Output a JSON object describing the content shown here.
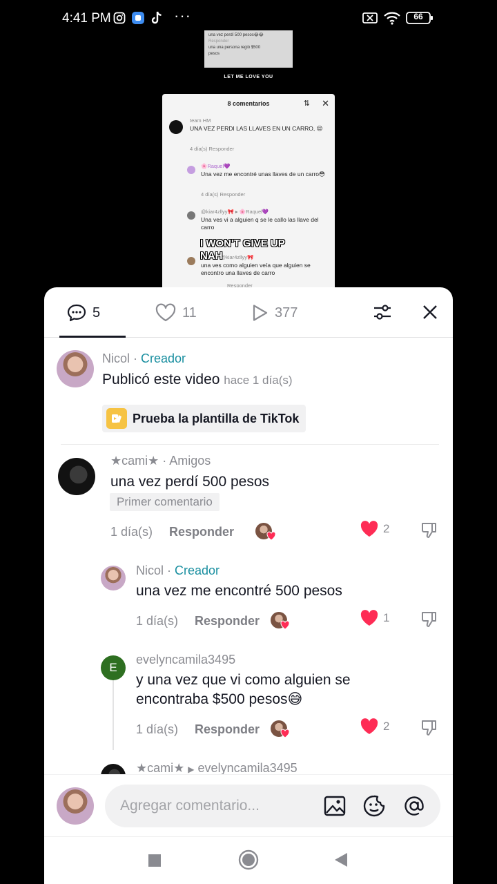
{
  "status": {
    "time": "4:41 PM",
    "battery": "66"
  },
  "video": {
    "top_thumb_lines": [
      "una vez perdí 500 pesos😂😂",
      "Responder",
      "una una persona regió $500",
      "pesos"
    ],
    "song_text": "LET ME LOVE YOU",
    "card": {
      "title": "8 comentarios",
      "c1_user": "team HM",
      "c1_text": "UNA VEZ PERDI LAS LLAVES EN UN CARRO, 😔",
      "c1_meta": "4 día(s)     Responder",
      "c2_user": "🌸Raquel💜",
      "c2_text": "Una vez me encontré unas llaves de un carro😳",
      "c2_meta": "4 día(s)     Responder",
      "c3_user": "@kiar4zllyy🎀 ▸ 🌸Raquel💜",
      "c3_text": "Una ves vi a alguien q se le callo las llave del carro",
      "c4_user": "@★... ▸ @kiar4zllyy🎀",
      "c4_text": "una ves como alguien veía que alguien se encontro una llaves de carro",
      "c4_meta": "Responder"
    },
    "overlay_line1": "I WON'T GIVE UP",
    "overlay_line2": "NAH"
  },
  "tabs": {
    "comments_count": "5",
    "likes_count": "11",
    "plays_count": "377"
  },
  "creator_post": {
    "name": "Nicol",
    "separator": " · ",
    "role": "Creador",
    "text": "Publicó este video",
    "since": "hace 1 día(s)",
    "template_label": "Prueba la plantilla de TikTok"
  },
  "comments": [
    {
      "name": "★cami★",
      "tag": " · Amigos",
      "text": "una vez perdí 500 pesos",
      "badge": "Primer comentario",
      "time": "1 día(s)",
      "reply": "Responder",
      "likes": "2"
    },
    {
      "name": "Nicol",
      "separator": " · ",
      "role": "Creador",
      "text": "una vez me encontré 500 pesos",
      "time": "1 día(s)",
      "reply": "Responder",
      "likes": "1"
    },
    {
      "name": "evelyncamila3495",
      "avatar_letter": "E",
      "text_line1": "y una vez que vi como alguien se",
      "text_line2": "encontraba $500 pesos😅",
      "time": "1 día(s)",
      "reply": "Responder",
      "likes": "2"
    },
    {
      "name": "★cami★",
      "reply_to": "evelyncamila3495"
    }
  ],
  "composer": {
    "placeholder": "Agregar comentario..."
  },
  "colors": {
    "like_red": "#fe2c55",
    "creator_teal": "#1a8fa0"
  }
}
